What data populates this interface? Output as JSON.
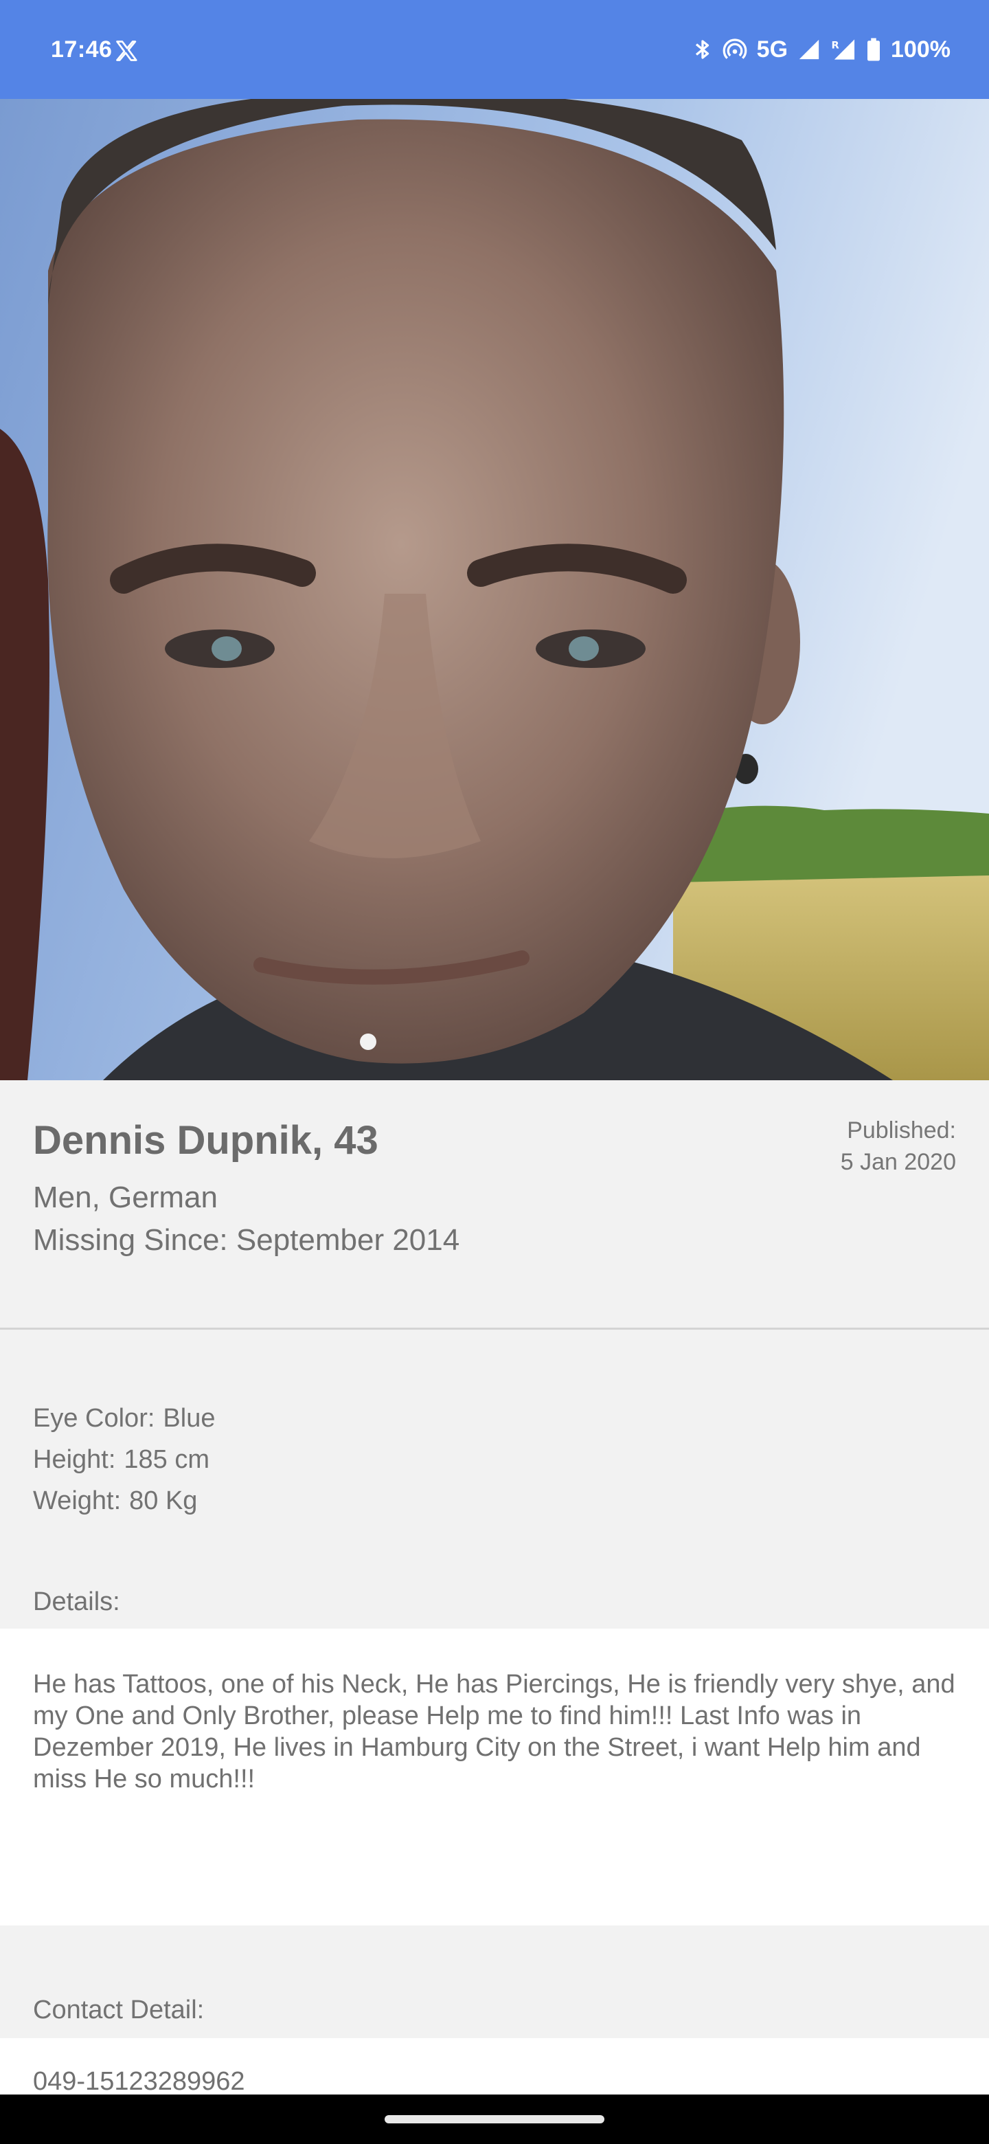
{
  "status_bar": {
    "time": "17:46",
    "network": "5G",
    "battery": "100%",
    "icons": [
      "x-app-icon",
      "bluetooth-icon",
      "hotspot-icon",
      "signal-icon",
      "signal-roaming-icon",
      "battery-icon"
    ],
    "background_color": "#5484e6"
  },
  "hero": {
    "photo": "missing-person-portrait-photo"
  },
  "profile": {
    "name_age": "Dennis Dupnik, 43",
    "gender_nationality": "Men, German",
    "missing_since": "Missing Since: September 2014",
    "published_label": "Published:",
    "published_date": "5 Jan 2020"
  },
  "attributes": {
    "eye_color_label": "Eye Color:",
    "eye_color_value": "Blue",
    "height_label": "Height:",
    "height_value": "185 cm",
    "weight_label": "Weight:",
    "weight_value": "80 Kg"
  },
  "details": {
    "label": "Details:",
    "text": "He has Tattoos, one of his Neck, He has Piercings, He is friendly very shye, and my One and Only Brother, please Help me to find him!!! Last Info was in Dezember 2019, He lives in Hamburg City on the Street, i want Help him and miss He so much!!!"
  },
  "contact": {
    "label": "Contact Detail:",
    "value": "049-15123289962"
  }
}
